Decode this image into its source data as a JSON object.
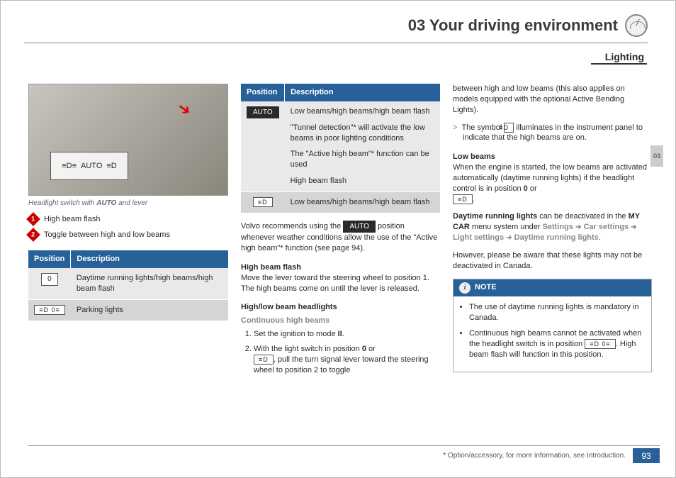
{
  "header": {
    "chapter": "03 Your driving environment",
    "section": "Lighting",
    "tab": "03"
  },
  "col1": {
    "caption_pre": "Headlight switch with ",
    "caption_bold": "AUTO",
    "caption_post": " and lever",
    "legend1": "High beam flash",
    "legend2": "Toggle between high and low beams",
    "table": {
      "h1": "Position",
      "h2": "Description",
      "r1_pos": "0",
      "r1_desc": "Daytime running lights/high beams/high beam flash",
      "r2_desc": "Parking lights"
    }
  },
  "col2": {
    "table": {
      "h1": "Position",
      "h2": "Description",
      "r1_a": "Low beams/high beams/high beam flash",
      "r1_b": "\"Tunnel detection\"* will activate the low beams in poor lighting conditions",
      "r1_c": "The \"Active high beam\"* function can be used",
      "r1_d": "High beam flash",
      "r2": "Low beams/high beams/high beam flash"
    },
    "p_reco_a": "Volvo recommends using the ",
    "p_reco_b": " position whenever weather conditions allow the use of the \"Active high beam\"* function (see page 94).",
    "h_flash": "High beam flash",
    "p_flash": "Move the lever toward the steering wheel to position 1. The high beams come on until the lever is released.",
    "h_hl": "High/low beam headlights",
    "h_cont": "Continuous high beams",
    "step1_a": "Set the ignition to mode ",
    "step1_b": "II",
    "step1_c": ".",
    "step2_a": "With the light switch in position ",
    "step2_b": "0",
    "step2_c": " or ",
    "step2_d": ", pull the turn signal lever toward the steering wheel to position 2 to toggle"
  },
  "col3": {
    "p_top": "between high and low beams (this also applies on models equipped with the optional Active Bending Lights).",
    "bullet_a": "The symbol ",
    "bullet_b": " illuminates in the instrument panel to indicate that the high beams are on.",
    "h_low": "Low beams",
    "p_low_a": "When the engine is started, the low beams are activated automatically (daytime running lights) if the headlight control is in position ",
    "p_low_b": "0",
    "p_low_c": " or ",
    "p_drl_a": "Daytime running lights",
    "p_drl_b": " can be deactivated in the ",
    "p_drl_c": "MY CAR",
    "p_drl_d": " menu system under ",
    "crumb1": "Settings",
    "crumb2": "Car settings",
    "crumb3": "Light settings",
    "crumb4": "Daytime running lights",
    "p_however": "However, please be aware that these lights may not be deactivated in Canada.",
    "note_title": "NOTE",
    "note_li1": "The use of daytime running lights is mandatory in Canada.",
    "note_li2_a": "Continuous high beams cannot be activated when the headlight switch is in position ",
    "note_li2_b": ". High beam flash will function in this position."
  },
  "footer": {
    "opt": "*",
    "text": " Option/accessory, for more information, see Introduction.",
    "page": "93"
  },
  "glyphs": {
    "auto": "AUTO",
    "beam": "≡D",
    "park": "≡D 0≡"
  }
}
